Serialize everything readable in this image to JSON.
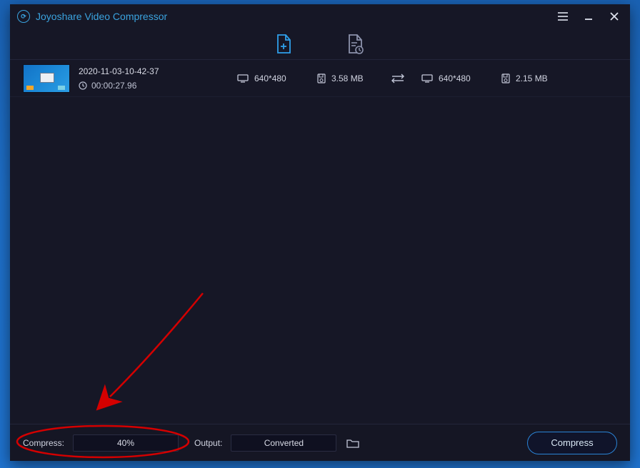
{
  "app": {
    "title": "Joyoshare Video Compressor"
  },
  "file": {
    "name": "2020-11-03-10-42-37",
    "duration": "00:00:27.96",
    "src_resolution": "640*480",
    "src_size": "3.58 MB",
    "dst_resolution": "640*480",
    "dst_size": "2.15 MB"
  },
  "bottom": {
    "compress_label": "Compress:",
    "compress_value": "40%",
    "output_label": "Output:",
    "output_value": "Converted",
    "action_label": "Compress"
  },
  "colors": {
    "accent": "#2a84d6"
  }
}
